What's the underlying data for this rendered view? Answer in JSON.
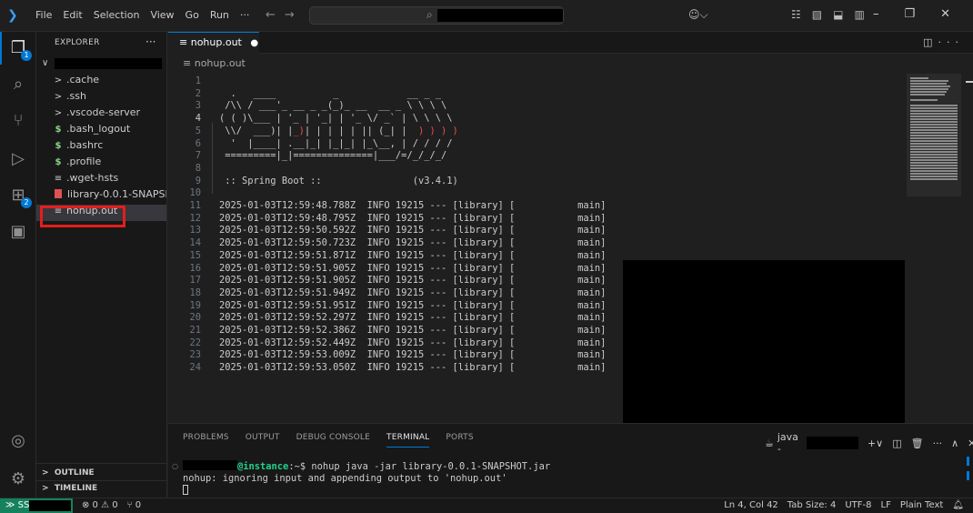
{
  "titlebar": {
    "menu": [
      "File",
      "Edit",
      "Selection",
      "View",
      "Go",
      "Run",
      "···"
    ]
  },
  "activitybar": {
    "explorer_badge": "1",
    "extensions_badge": "2"
  },
  "sidebar": {
    "title": "EXPLORER",
    "more": "···",
    "items": [
      {
        "label": ".cache",
        "icon": "chevron-right"
      },
      {
        "label": ".ssh",
        "icon": "chevron-right"
      },
      {
        "label": ".vscode-server",
        "icon": "chevron-right"
      },
      {
        "label": ".bash_logout",
        "icon": "dollar"
      },
      {
        "label": ".bashrc",
        "icon": "dollar"
      },
      {
        "label": ".profile",
        "icon": "dollar"
      },
      {
        "label": ".wget-hsts",
        "icon": "lines"
      },
      {
        "label": "library-0.0.1-SNAPSH...",
        "icon": "jar"
      },
      {
        "label": "nohup.out",
        "icon": "lines"
      }
    ],
    "outline": "OUTLINE",
    "timeline": "TIMELINE"
  },
  "editor": {
    "tab_label": "nohup.out",
    "breadcrumb": "nohup.out",
    "banner": [
      "",
      "  .   ____          _            __ _ _",
      " /\\\\ / ___'_ __ _ _(_)_ __  __ _ \\ \\ \\ \\",
      "( ( )\\___ | '_ | '_| | '_ \\/ _` | \\ \\ \\ \\",
      " \\\\/  ___)| |_)| | | | | || (_| |  ) ) ) )",
      "  '  |____| .__|_| |_|_| |_\\__, | / / / /",
      " =========|_|==============|___/=/_/_/_/",
      "",
      " :: Spring Boot ::                (v3.4.1)",
      ""
    ],
    "log_lines": [
      "2025-01-03T12:59:48.788Z  INFO 19215 --- [library] [           main]",
      "2025-01-03T12:59:48.795Z  INFO 19215 --- [library] [           main]",
      "2025-01-03T12:59:50.592Z  INFO 19215 --- [library] [           main]",
      "2025-01-03T12:59:50.723Z  INFO 19215 --- [library] [           main]",
      "2025-01-03T12:59:51.871Z  INFO 19215 --- [library] [           main]",
      "2025-01-03T12:59:51.905Z  INFO 19215 --- [library] [           main]",
      "2025-01-03T12:59:51.905Z  INFO 19215 --- [library] [           main]",
      "2025-01-03T12:59:51.949Z  INFO 19215 --- [library] [           main]",
      "2025-01-03T12:59:51.951Z  INFO 19215 --- [library] [           main]",
      "2025-01-03T12:59:52.297Z  INFO 19215 --- [library] [           main]",
      "2025-01-03T12:59:52.386Z  INFO 19215 --- [library] [           main]",
      "2025-01-03T12:59:52.449Z  INFO 19215 --- [library] [           main]",
      "2025-01-03T12:59:53.009Z  INFO 19215 --- [library] [           main]",
      "2025-01-03T12:59:53.050Z  INFO 19215 --- [library] [           main]"
    ]
  },
  "panel": {
    "tabs": [
      "PROBLEMS",
      "OUTPUT",
      "DEBUG CONSOLE",
      "TERMINAL",
      "PORTS"
    ],
    "active_tab": "TERMINAL",
    "terminal_name": "java -",
    "prompt_host": "@instance",
    "prompt_path": ":~$ ",
    "command": "nohup java -jar library-0.0.1-SNAPSHOT.jar",
    "output": "nohup: ignoring input and appending output to 'nohup.out'"
  },
  "statusbar": {
    "remote": "SSH:",
    "problems": "⊗ 0 ⚠ 0",
    "ports": "0",
    "position": "Ln 4, Col 42",
    "tab_size": "Tab Size: 4",
    "encoding": "UTF-8",
    "eol": "LF",
    "language": "Plain Text"
  },
  "colors": {
    "accent": "#0078d4",
    "remote_bg": "#16825d",
    "highlight_box": "#e51d1d",
    "banner_yellow": "#ffd700"
  }
}
